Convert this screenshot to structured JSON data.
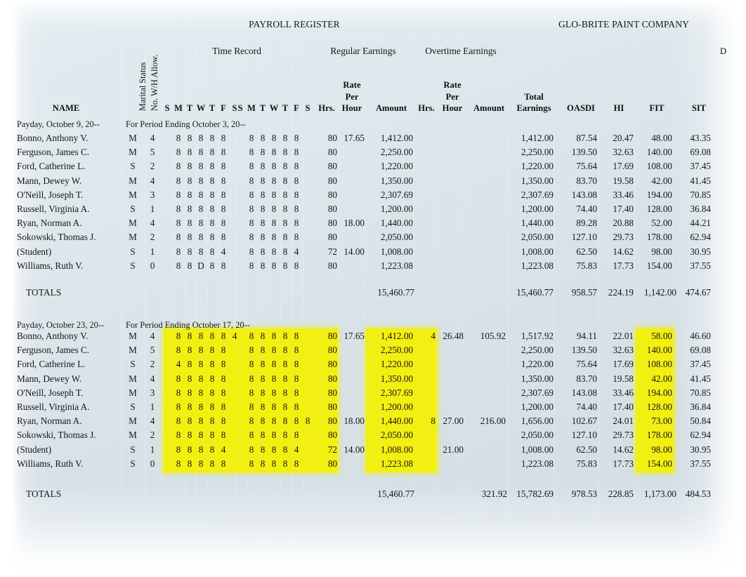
{
  "document": {
    "title": "PAYROLL REGISTER",
    "company": "GLO-BRITE PAINT COMPANY",
    "cut_off_header": "D"
  },
  "group_headers": {
    "time_record": "Time Record",
    "regular_earnings": "Regular Earnings",
    "overtime_earnings": "Overtime Earnings"
  },
  "column_headers": {
    "name": "NAME",
    "marital_status": "Marital Status",
    "wh_allow": "No. W/H Allow.",
    "days": [
      "S",
      "M",
      "T",
      "W",
      "T",
      "F",
      "S",
      "S",
      "M",
      "T",
      "W",
      "T",
      "F",
      "S"
    ],
    "hrs": "Hrs.",
    "rate_per_hour_1": "Rate",
    "rate_per_hour_2": "Per",
    "rate_per_hour_3": "Hour",
    "amount": "Amount",
    "ot_hrs": "Hrs.",
    "ot_rate_1": "Rate",
    "ot_rate_2": "Per",
    "ot_rate_3": "Hour",
    "ot_amount": "Amount",
    "total_earnings_1": "Total",
    "total_earnings_2": "Earnings",
    "oasdi": "OASDI",
    "hi": "HI",
    "fit": "FIT",
    "sit": "SIT"
  },
  "sections": [
    {
      "payday": "Payday, October 9, 20--",
      "period": "For Period Ending October 3, 20--",
      "rows": [
        {
          "name": "Bonno, Anthony V.",
          "ms": "M",
          "allow": "4",
          "days": [
            "",
            "8",
            "8",
            "8",
            "8",
            "8",
            "",
            "",
            "8",
            "8",
            "8",
            "8",
            "8",
            ""
          ],
          "hrs": "80",
          "rate": "17.65",
          "amount": "1,412.00",
          "ot_hrs": "",
          "ot_rate": "",
          "ot_amount": "",
          "total": "1,412.00",
          "oasdi": "87.54",
          "hi": "20.47",
          "fit": "48.00",
          "sit": "43.35"
        },
        {
          "name": "Ferguson, James C.",
          "ms": "M",
          "allow": "5",
          "days": [
            "",
            "8",
            "8",
            "8",
            "8",
            "8",
            "",
            "",
            "8",
            "8",
            "8",
            "8",
            "8",
            ""
          ],
          "hrs": "80",
          "rate": "",
          "amount": "2,250.00",
          "ot_hrs": "",
          "ot_rate": "",
          "ot_amount": "",
          "total": "2,250.00",
          "oasdi": "139.50",
          "hi": "32.63",
          "fit": "140.00",
          "sit": "69.08"
        },
        {
          "name": "Ford, Catherine L.",
          "ms": "S",
          "allow": "2",
          "days": [
            "",
            "8",
            "8",
            "8",
            "8",
            "8",
            "",
            "",
            "8",
            "8",
            "8",
            "8",
            "8",
            ""
          ],
          "hrs": "80",
          "rate": "",
          "amount": "1,220.00",
          "ot_hrs": "",
          "ot_rate": "",
          "ot_amount": "",
          "total": "1,220.00",
          "oasdi": "75.64",
          "hi": "17.69",
          "fit": "108.00",
          "sit": "37.45"
        },
        {
          "name": "Mann, Dewey W.",
          "ms": "M",
          "allow": "4",
          "days": [
            "",
            "8",
            "8",
            "8",
            "8",
            "8",
            "",
            "",
            "8",
            "8",
            "8",
            "8",
            "8",
            ""
          ],
          "hrs": "80",
          "rate": "",
          "amount": "1,350.00",
          "ot_hrs": "",
          "ot_rate": "",
          "ot_amount": "",
          "total": "1,350.00",
          "oasdi": "83.70",
          "hi": "19.58",
          "fit": "42.00",
          "sit": "41.45"
        },
        {
          "name": "O'Neill, Joseph T.",
          "ms": "M",
          "allow": "3",
          "days": [
            "",
            "8",
            "8",
            "8",
            "8",
            "8",
            "",
            "",
            "8",
            "8",
            "8",
            "8",
            "8",
            ""
          ],
          "hrs": "80",
          "rate": "",
          "amount": "2,307.69",
          "ot_hrs": "",
          "ot_rate": "",
          "ot_amount": "",
          "total": "2,307.69",
          "oasdi": "143.08",
          "hi": "33.46",
          "fit": "194.00",
          "sit": "70.85"
        },
        {
          "name": "Russell, Virginia A.",
          "ms": "S",
          "allow": "1",
          "days": [
            "",
            "8",
            "8",
            "8",
            "8",
            "8",
            "",
            "",
            "8",
            "8",
            "8",
            "8",
            "8",
            ""
          ],
          "hrs": "80",
          "rate": "",
          "amount": "1,200.00",
          "ot_hrs": "",
          "ot_rate": "",
          "ot_amount": "",
          "total": "1,200.00",
          "oasdi": "74.40",
          "hi": "17.40",
          "fit": "128.00",
          "sit": "36.84"
        },
        {
          "name": "Ryan, Norman A.",
          "ms": "M",
          "allow": "4",
          "days": [
            "",
            "8",
            "8",
            "8",
            "8",
            "8",
            "",
            "",
            "8",
            "8",
            "8",
            "8",
            "8",
            ""
          ],
          "hrs": "80",
          "rate": "18.00",
          "amount": "1,440.00",
          "ot_hrs": "",
          "ot_rate": "",
          "ot_amount": "",
          "total": "1,440.00",
          "oasdi": "89.28",
          "hi": "20.88",
          "fit": "52.00",
          "sit": "44.21"
        },
        {
          "name": "Sokowski, Thomas J.",
          "ms": "M",
          "allow": "2",
          "days": [
            "",
            "8",
            "8",
            "8",
            "8",
            "8",
            "",
            "",
            "8",
            "8",
            "8",
            "8",
            "8",
            ""
          ],
          "hrs": "80",
          "rate": "",
          "amount": "2,050.00",
          "ot_hrs": "",
          "ot_rate": "",
          "ot_amount": "",
          "total": "2,050.00",
          "oasdi": "127.10",
          "hi": "29.73",
          "fit": "178.00",
          "sit": "62.94"
        },
        {
          "name": "(Student)",
          "ms": "S",
          "allow": "1",
          "days": [
            "",
            "8",
            "8",
            "8",
            "8",
            "4",
            "",
            "",
            "8",
            "8",
            "8",
            "8",
            "4",
            ""
          ],
          "hrs": "72",
          "rate": "14.00",
          "amount": "1,008.00",
          "ot_hrs": "",
          "ot_rate": "",
          "ot_amount": "",
          "total": "1,008.00",
          "oasdi": "62.50",
          "hi": "14.62",
          "fit": "98.00",
          "sit": "30.95"
        },
        {
          "name": "Williams, Ruth V.",
          "ms": "S",
          "allow": "0",
          "days": [
            "",
            "8",
            "8",
            "D",
            "8",
            "8",
            "",
            "",
            "8",
            "8",
            "8",
            "8",
            "8",
            ""
          ],
          "hrs": "80",
          "rate": "",
          "amount": "1,223.08",
          "ot_hrs": "",
          "ot_rate": "",
          "ot_amount": "",
          "total": "1,223.08",
          "oasdi": "75.83",
          "hi": "17.73",
          "fit": "154.00",
          "sit": "37.55"
        }
      ],
      "totals": {
        "label": "TOTALS",
        "amount": "15,460.77",
        "ot_amount": "",
        "total": "15,460.77",
        "oasdi": "958.57",
        "hi": "224.19",
        "fit": "1,142.00",
        "sit": "474.67"
      }
    },
    {
      "payday": "Payday, October 23, 20--",
      "period": "For Period Ending October 17, 20--",
      "rows": [
        {
          "name": "Bonno, Anthony V.",
          "ms": "M",
          "allow": "4",
          "days": [
            "",
            "8",
            "8",
            "8",
            "8",
            "8",
            "4",
            "",
            "8",
            "8",
            "8",
            "8",
            "8",
            ""
          ],
          "hrs": "80",
          "rate": "17.65",
          "amount": "1,412.00",
          "ot_hrs": "4",
          "ot_rate": "26.48",
          "ot_amount": "105.92",
          "total": "1,517.92",
          "oasdi": "94.11",
          "hi": "22.01",
          "fit": "58.00",
          "sit": "46.60"
        },
        {
          "name": "Ferguson, James C.",
          "ms": "M",
          "allow": "5",
          "days": [
            "",
            "8",
            "8",
            "8",
            "8",
            "8",
            "",
            "",
            "8",
            "8",
            "8",
            "8",
            "8",
            ""
          ],
          "hrs": "80",
          "rate": "",
          "amount": "2,250.00",
          "ot_hrs": "",
          "ot_rate": "",
          "ot_amount": "",
          "total": "2,250.00",
          "oasdi": "139.50",
          "hi": "32.63",
          "fit": "140.00",
          "sit": "69.08"
        },
        {
          "name": "Ford, Catherine L.",
          "ms": "S",
          "allow": "2",
          "days": [
            "",
            "4",
            "8",
            "8",
            "8",
            "8",
            "",
            "",
            "8",
            "8",
            "8",
            "8",
            "8",
            ""
          ],
          "hrs": "80",
          "rate": "",
          "amount": "1,220.00",
          "ot_hrs": "",
          "ot_rate": "",
          "ot_amount": "",
          "total": "1,220.00",
          "oasdi": "75.64",
          "hi": "17.69",
          "fit": "108.00",
          "sit": "37.45"
        },
        {
          "name": "Mann, Dewey W.",
          "ms": "M",
          "allow": "4",
          "days": [
            "",
            "8",
            "8",
            "8",
            "8",
            "8",
            "",
            "",
            "8",
            "8",
            "8",
            "8",
            "8",
            ""
          ],
          "hrs": "80",
          "rate": "",
          "amount": "1,350.00",
          "ot_hrs": "",
          "ot_rate": "",
          "ot_amount": "",
          "total": "1,350.00",
          "oasdi": "83.70",
          "hi": "19.58",
          "fit": "42.00",
          "sit": "41.45"
        },
        {
          "name": "O'Neill, Joseph T.",
          "ms": "M",
          "allow": "3",
          "days": [
            "",
            "8",
            "8",
            "8",
            "8",
            "8",
            "",
            "",
            "8",
            "8",
            "8",
            "8",
            "8",
            ""
          ],
          "hrs": "80",
          "rate": "",
          "amount": "2,307.69",
          "ot_hrs": "",
          "ot_rate": "",
          "ot_amount": "",
          "total": "2,307.69",
          "oasdi": "143.08",
          "hi": "33.46",
          "fit": "194.00",
          "sit": "70.85"
        },
        {
          "name": "Russell, Virginia A.",
          "ms": "S",
          "allow": "1",
          "days": [
            "",
            "8",
            "8",
            "8",
            "8",
            "8",
            "",
            "",
            "8",
            "8",
            "8",
            "8",
            "8",
            ""
          ],
          "hrs": "80",
          "rate": "",
          "amount": "1,200.00",
          "ot_hrs": "",
          "ot_rate": "",
          "ot_amount": "",
          "total": "1,200.00",
          "oasdi": "74.40",
          "hi": "17.40",
          "fit": "128.00",
          "sit": "36.84"
        },
        {
          "name": "Ryan, Norman A.",
          "ms": "M",
          "allow": "4",
          "days": [
            "",
            "8",
            "8",
            "8",
            "8",
            "8",
            "",
            "",
            "8",
            "8",
            "8",
            "8",
            "8",
            "8"
          ],
          "hrs": "80",
          "rate": "18.00",
          "amount": "1,440.00",
          "ot_hrs": "8",
          "ot_rate": "27.00",
          "ot_amount": "216.00",
          "total": "1,656.00",
          "oasdi": "102.67",
          "hi": "24.01",
          "fit": "73.00",
          "sit": "50.84"
        },
        {
          "name": "Sokowski, Thomas J.",
          "ms": "M",
          "allow": "2",
          "days": [
            "",
            "8",
            "8",
            "8",
            "8",
            "8",
            "",
            "",
            "8",
            "8",
            "8",
            "8",
            "8",
            ""
          ],
          "hrs": "80",
          "rate": "",
          "amount": "2,050.00",
          "ot_hrs": "",
          "ot_rate": "",
          "ot_amount": "",
          "total": "2,050.00",
          "oasdi": "127.10",
          "hi": "29.73",
          "fit": "178.00",
          "sit": "62.94"
        },
        {
          "name": "(Student)",
          "ms": "S",
          "allow": "1",
          "days": [
            "",
            "8",
            "8",
            "8",
            "8",
            "4",
            "",
            "",
            "8",
            "8",
            "8",
            "8",
            "4",
            ""
          ],
          "hrs": "72",
          "rate": "14.00",
          "amount": "1,008.00",
          "ot_hrs": "",
          "ot_rate": "21.00",
          "ot_amount": "",
          "total": "1,008.00",
          "oasdi": "62.50",
          "hi": "14.62",
          "fit": "98.00",
          "sit": "30.95"
        },
        {
          "name": "Williams, Ruth V.",
          "ms": "S",
          "allow": "0",
          "days": [
            "",
            "8",
            "8",
            "8",
            "8",
            "8",
            "",
            "",
            "8",
            "8",
            "8",
            "8",
            "8",
            ""
          ],
          "hrs": "80",
          "rate": "",
          "amount": "1,223.08",
          "ot_hrs": "",
          "ot_rate": "",
          "ot_amount": "",
          "total": "1,223.08",
          "oasdi": "75.83",
          "hi": "17.73",
          "fit": "154.00",
          "sit": "37.55"
        }
      ],
      "totals": {
        "label": "TOTALS",
        "amount": "15,460.77",
        "ot_amount": "321.92",
        "total": "15,782.69",
        "oasdi": "978.53",
        "hi": "228.85",
        "fit": "1,173.00",
        "sit": "484.53"
      }
    }
  ],
  "colors": {
    "highlight": "#f2ef13",
    "sheet_background": "#dde7ec",
    "text": "#171717"
  }
}
